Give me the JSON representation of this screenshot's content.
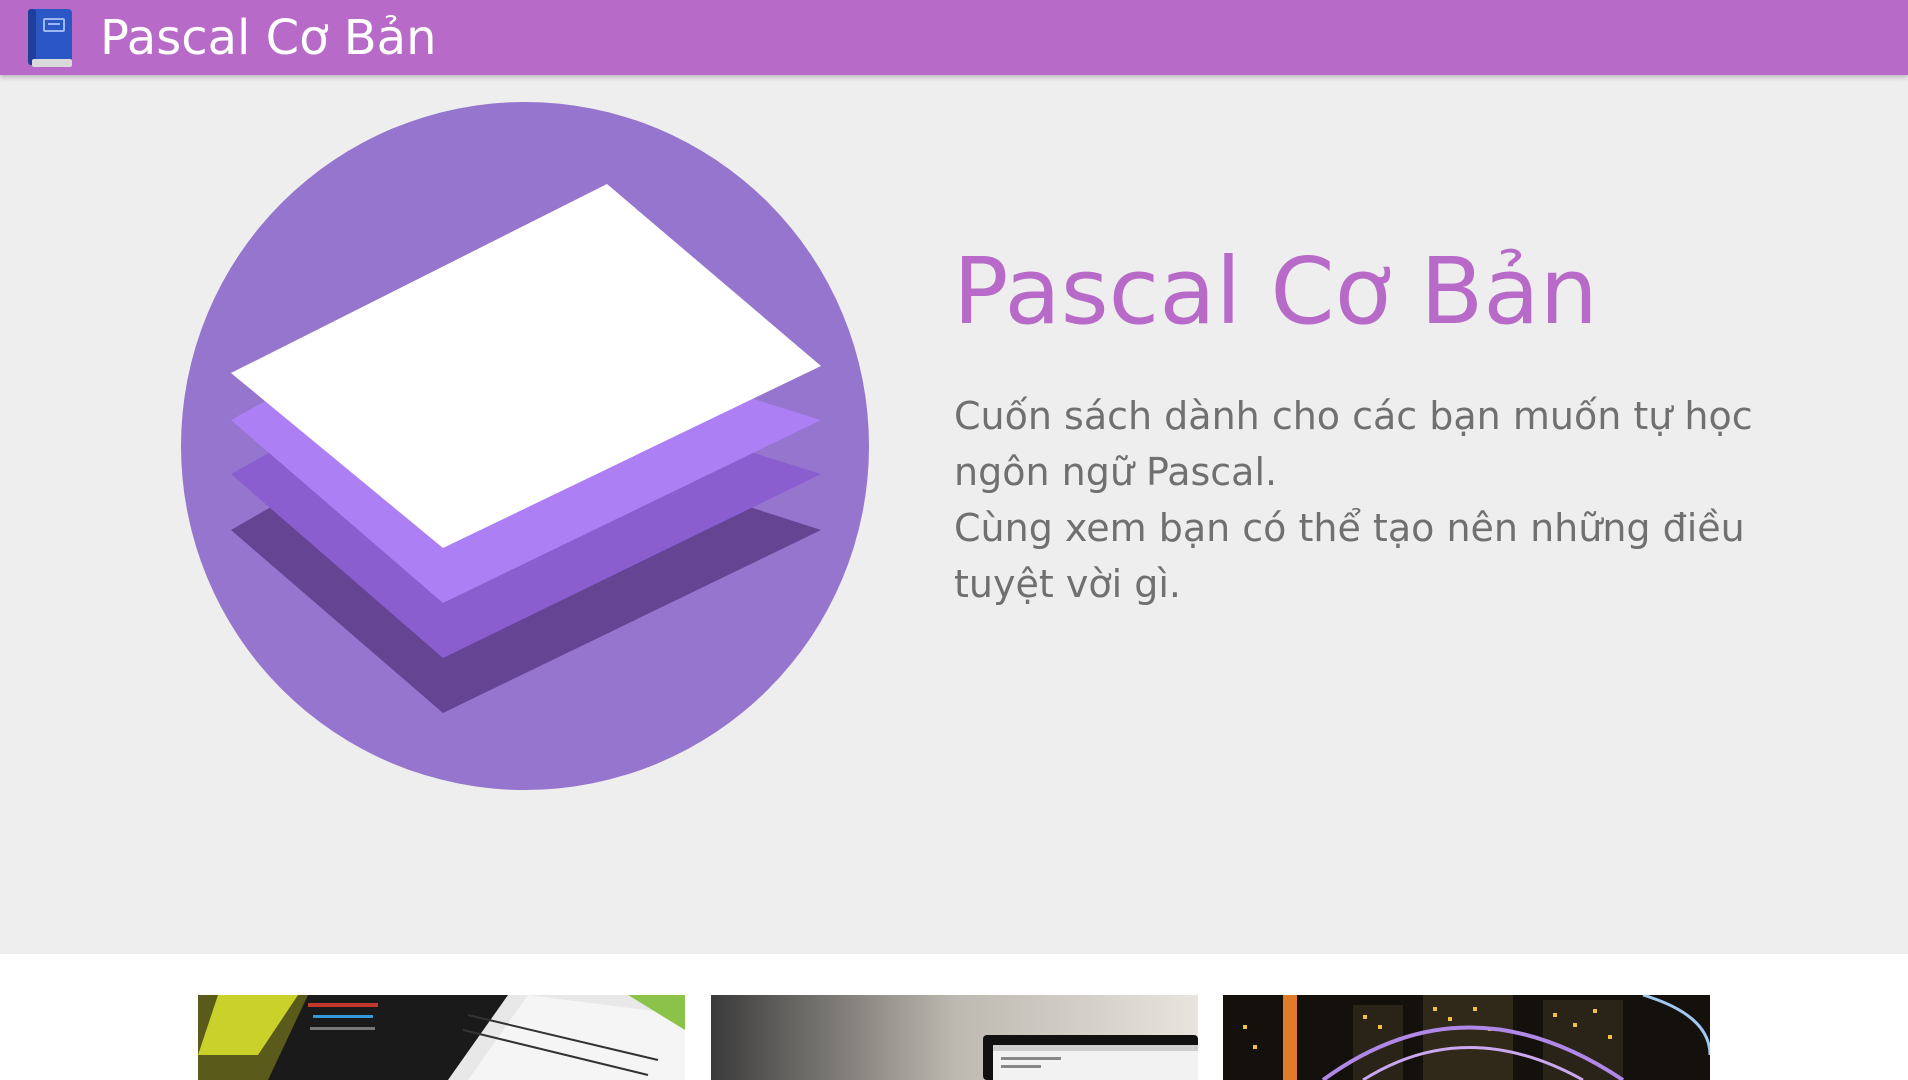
{
  "appbar": {
    "title": "Pascal Cơ Bản",
    "logo_icon": "blue-book-icon",
    "background_color": "#b76ac8"
  },
  "hero": {
    "headline": "Pascal Cơ Bản",
    "description_lines": [
      "Cuốn sách dành cho các bạn muốn tự học ngôn ngữ Pascal.",
      "Cùng xem bạn có thể tạo nên những điều tuyệt vời gì."
    ],
    "illustration_icon": "layers-icon",
    "headline_color": "#b76ac8",
    "circle_color": "#9575cd",
    "background_color": "#eeeeee"
  },
  "cards": [
    {
      "image_icon": "terminal-screen-photo-icon"
    },
    {
      "image_icon": "laptop-code-photo-icon"
    },
    {
      "image_icon": "city-night-photo-icon"
    }
  ]
}
